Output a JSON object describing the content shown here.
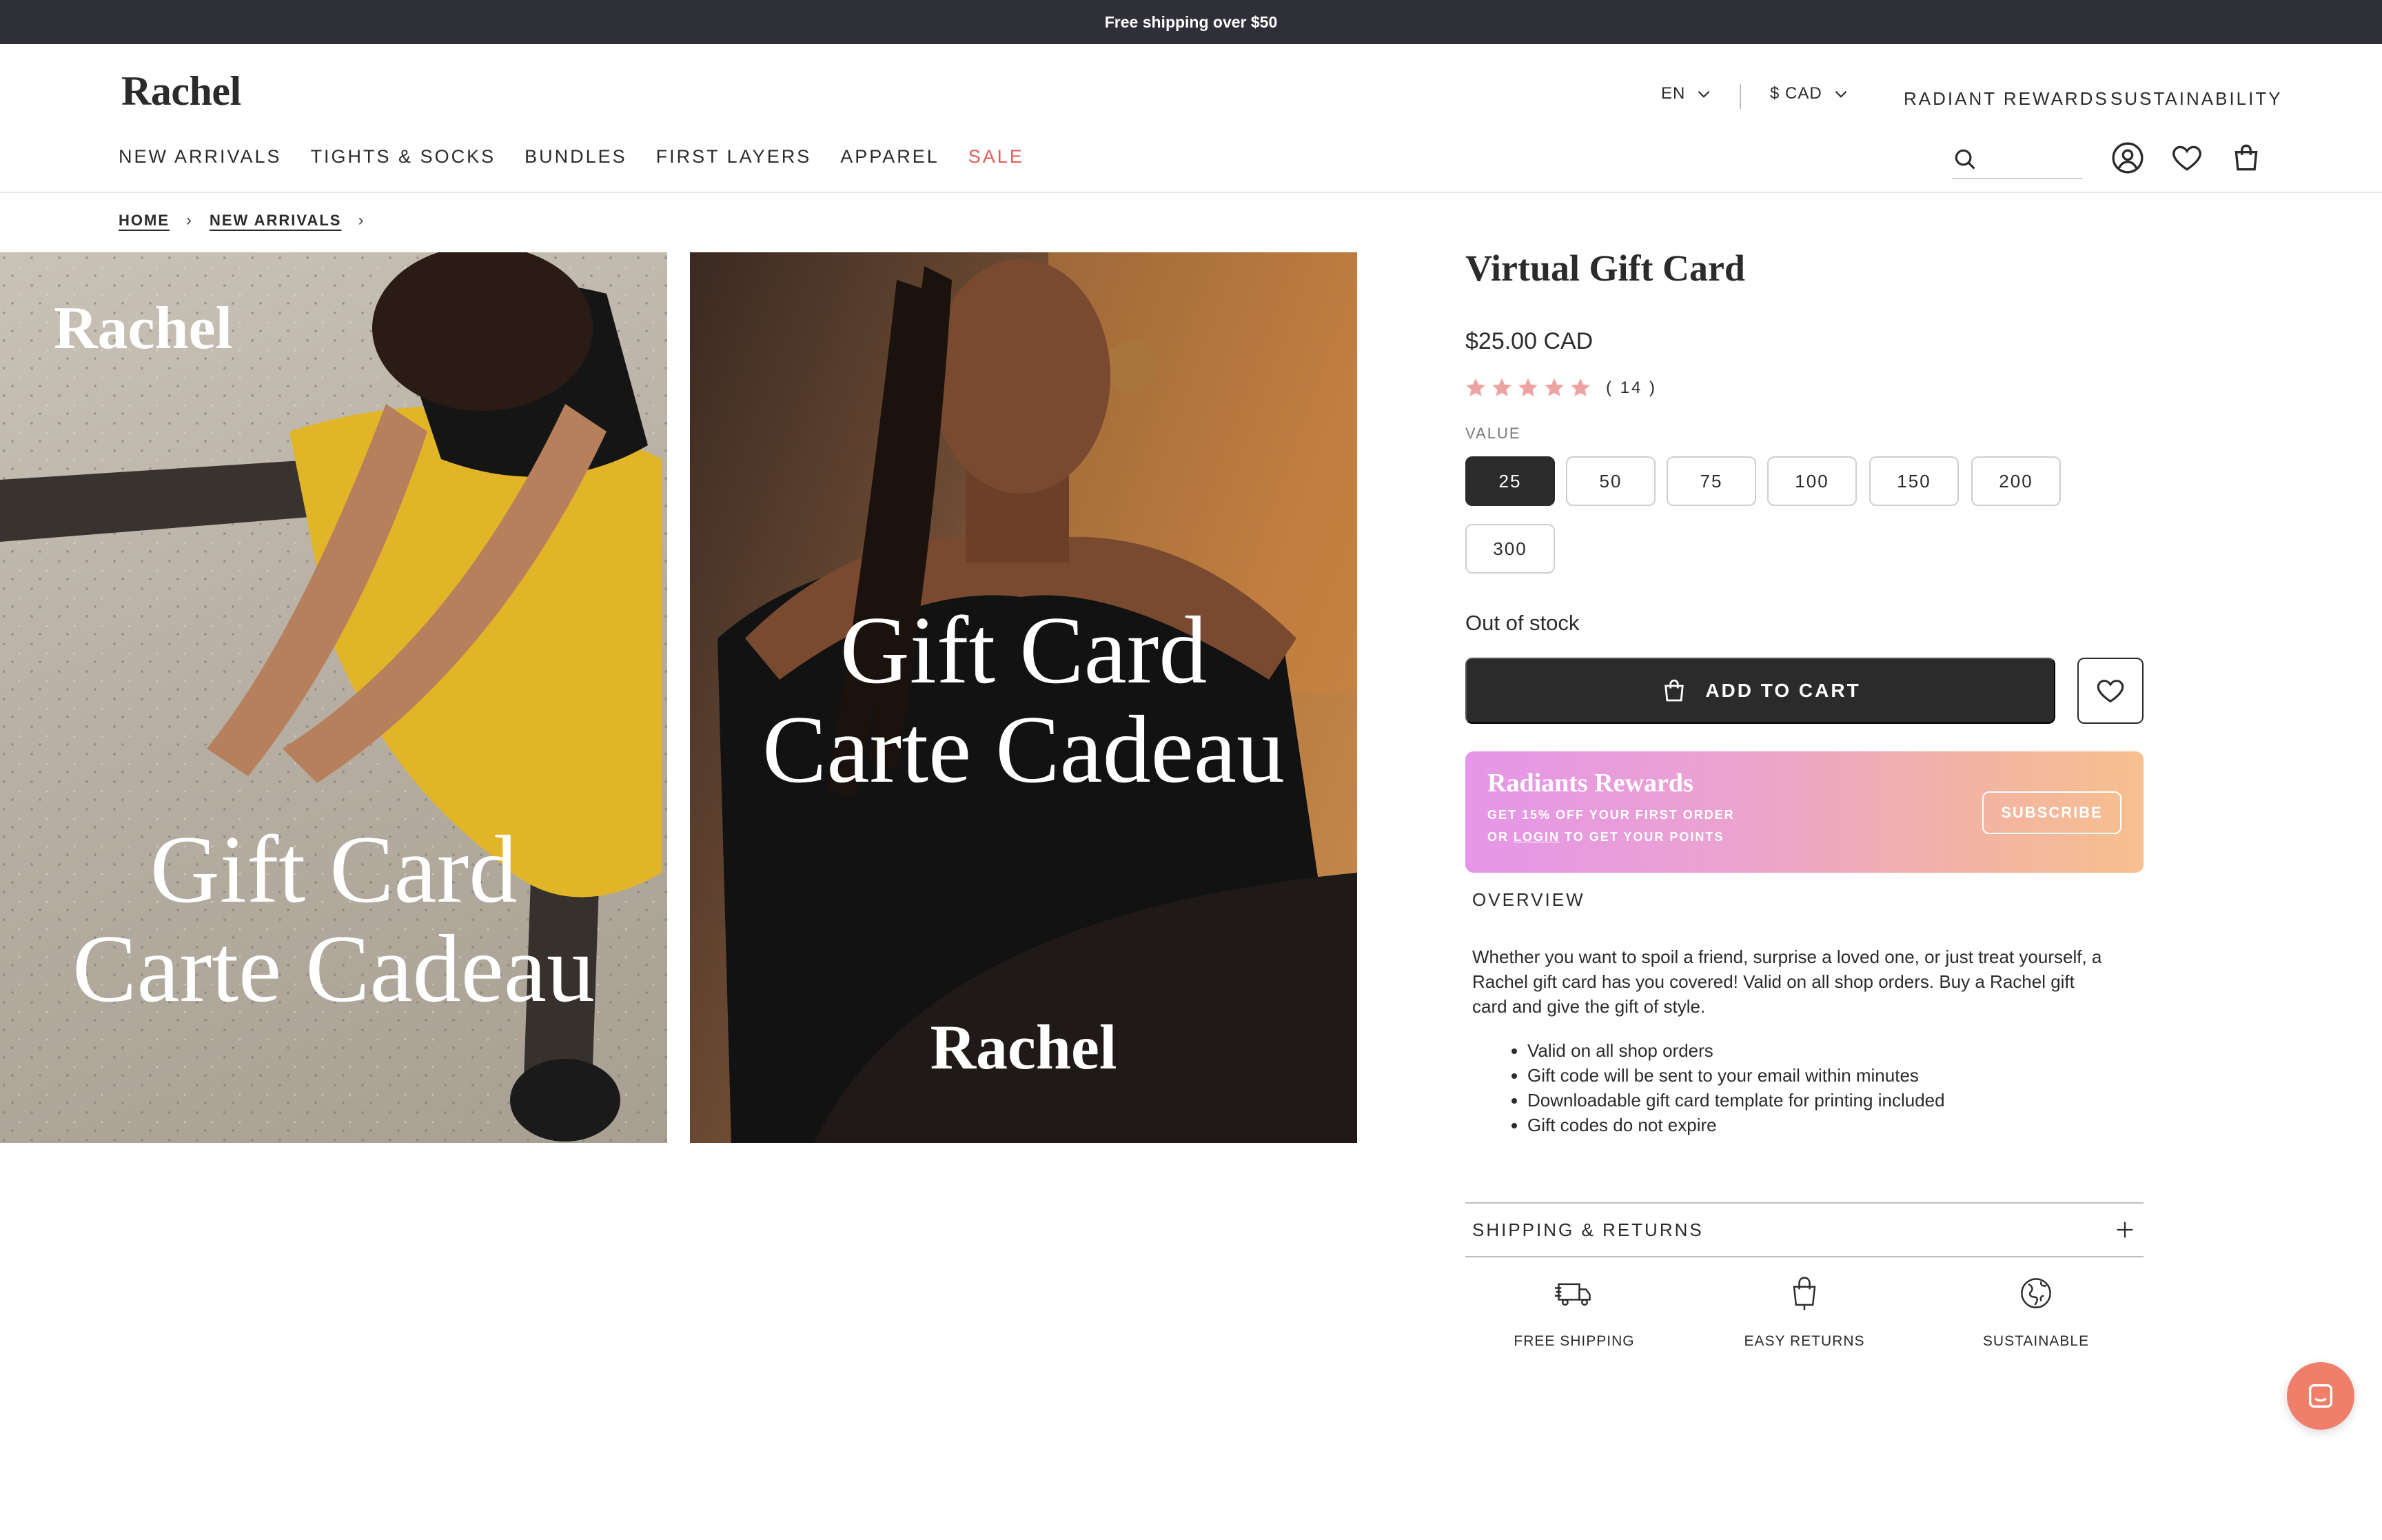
{
  "announcement": "Free shipping over $50",
  "header": {
    "logo": "Rachel",
    "language": "EN",
    "currency": "$ CAD",
    "links": [
      "RADIANT REWARDS",
      "SUSTAINABILITY"
    ],
    "nav": [
      "NEW ARRIVALS",
      "TIGHTS & SOCKS",
      "BUNDLES",
      "FIRST LAYERS",
      "APPAREL",
      "SALE"
    ],
    "search_placeholder": ""
  },
  "breadcrumb": [
    "HOME",
    "NEW ARRIVALS"
  ],
  "gallery": [
    {
      "logo": "Rachel",
      "line1": "Gift Card",
      "line2": "Carte Cadeau"
    },
    {
      "logo": "Rachel",
      "line1": "Gift Card",
      "line2": "Carte Cadeau"
    }
  ],
  "product": {
    "title": "Virtual Gift Card",
    "price": "$25.00 CAD",
    "rating": 5,
    "reviews": "( 14 )",
    "value_label": "VALUE",
    "options": [
      "25",
      "50",
      "75",
      "100",
      "150",
      "200",
      "300"
    ],
    "selected_option": "25",
    "stock": "Out of stock",
    "add_to_cart": "ADD TO CART"
  },
  "rewards": {
    "title": "Radiants Rewards",
    "line1": "GET 15% OFF YOUR FIRST ORDER",
    "line2_prefix": "OR",
    "line2_link": "LOGIN",
    "line2_suffix": "TO GET YOUR POINTS",
    "button": "SUBSCRIBE"
  },
  "overview": {
    "heading": "OVERVIEW",
    "text": "Whether you want to spoil a friend, surprise a loved one, or just treat yourself, a Rachel gift card has you covered! Valid on all shop orders. Buy a Rachel gift card and give the gift of style.",
    "bullets": [
      "Valid on all shop orders",
      "Gift code will be sent to your email within minutes",
      "Downloadable gift card template for printing included",
      "Gift codes do not expire"
    ]
  },
  "shipping_returns": "SHIPPING & RETURNS",
  "features": [
    "FREE SHIPPING",
    "EASY RETURNS",
    "SUSTAINABLE"
  ],
  "colors": {
    "announce_bg": "#2f2f37",
    "dark": "#2b2b2b",
    "sale": "#e05b5b",
    "star": "#eea3a3",
    "chat": "#ef7e6a"
  }
}
